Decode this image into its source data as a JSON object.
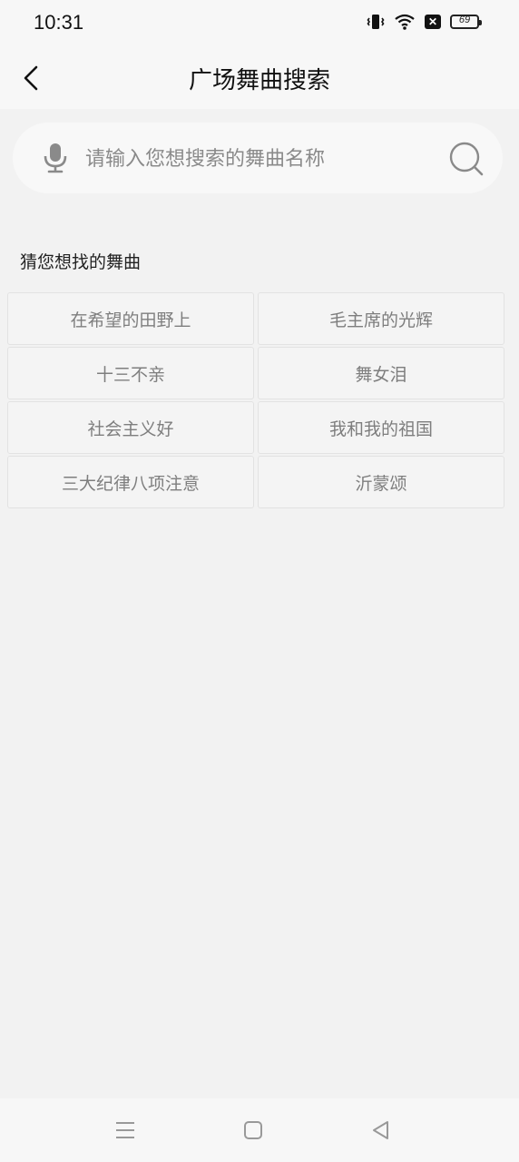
{
  "status": {
    "time": "10:31",
    "battery": "69"
  },
  "header": {
    "title": "广场舞曲搜索"
  },
  "search": {
    "placeholder": "请输入您想搜索的舞曲名称"
  },
  "suggestions": {
    "title": "猜您想找的舞曲",
    "items": [
      "在希望的田野上",
      "毛主席的光辉",
      "十三不亲",
      "舞女泪",
      "社会主义好",
      "我和我的祖国",
      "三大纪律八项注意",
      "沂蒙颂"
    ]
  },
  "icons": {
    "back": "chevron-left-icon",
    "mic": "microphone-icon",
    "search": "search-icon",
    "nav_menu": "menu-icon",
    "nav_home": "home-icon",
    "nav_back": "triangle-back-icon"
  }
}
